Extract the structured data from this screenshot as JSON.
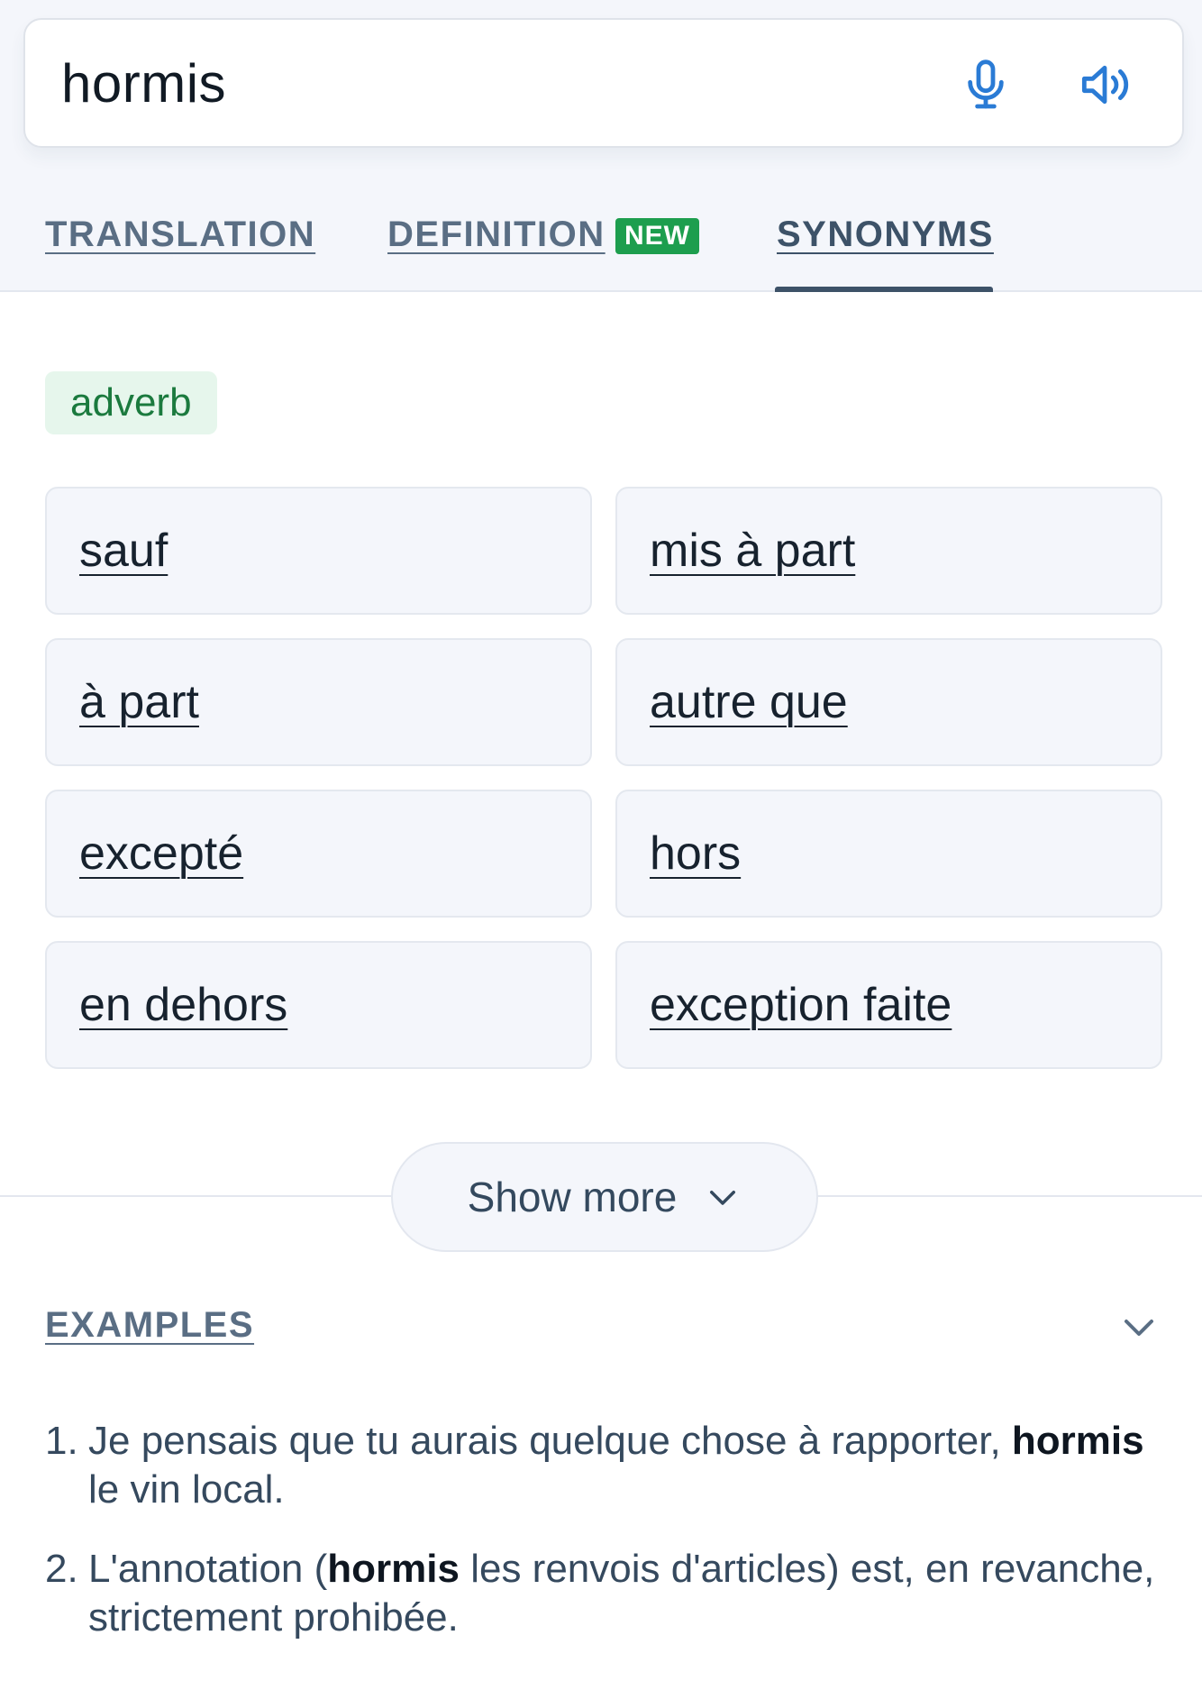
{
  "search": {
    "query": "hormis",
    "mic_icon": "microphone-icon",
    "speaker_icon": "speaker-icon"
  },
  "tabs": [
    {
      "label": "TRANSLATION",
      "active": false
    },
    {
      "label": "DEFINITION",
      "badge": "NEW",
      "active": false
    },
    {
      "label": "SYNONYMS",
      "active": true
    }
  ],
  "synonyms": {
    "part_of_speech": "adverb",
    "items": [
      "sauf",
      "mis à part",
      "à part",
      "autre que",
      "excepté",
      "hors",
      "en dehors",
      "exception faite"
    ],
    "show_more_label": "Show more"
  },
  "examples": {
    "title": "EXAMPLES",
    "items": [
      {
        "number": "1.",
        "before": "Je pensais que tu aurais quelque chose à rapporter, ",
        "highlight": "hormis",
        "after": " le vin local."
      },
      {
        "number": "2.",
        "before": "L'annotation (",
        "highlight": "hormis",
        "after": " les renvois d'articles) est, en revanche, strictement prohibée."
      }
    ]
  },
  "colors": {
    "accent_blue": "#2a7bd5",
    "badge_green": "#1d9e4e",
    "chip_bg": "#e6f6ec",
    "chip_text": "#1b7a3e"
  }
}
